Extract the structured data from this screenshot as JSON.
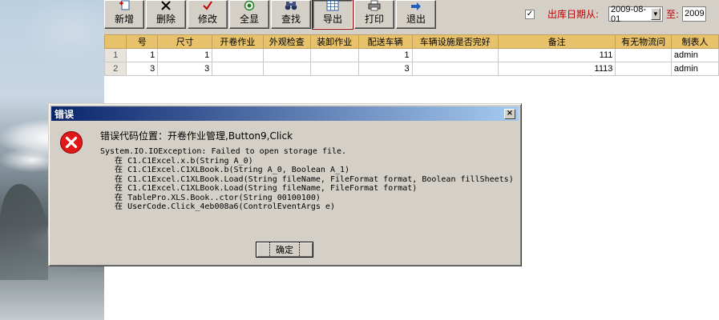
{
  "toolbar": {
    "buttons": [
      {
        "label": "新增",
        "icon": "add-icon"
      },
      {
        "label": "删除",
        "icon": "delete-icon"
      },
      {
        "label": "修改",
        "icon": "check-icon"
      },
      {
        "label": "全显",
        "icon": "show-all-icon"
      },
      {
        "label": "查找",
        "icon": "binoculars-icon"
      },
      {
        "label": "导出",
        "icon": "export-grid-icon"
      },
      {
        "label": "打印",
        "icon": "printer-icon"
      },
      {
        "label": "退出",
        "icon": "exit-arrow-icon"
      }
    ]
  },
  "filter": {
    "checked": true,
    "from_label": "出库日期从:",
    "from_value": "2009-08-01",
    "to_label": "至:",
    "to_value": "2009"
  },
  "grid": {
    "columns": [
      "号",
      "尺寸",
      "开卷作业",
      "外观检查",
      "装卸作业",
      "配送车辆",
      "车辆设施是否完好",
      "备注",
      "有无物流问",
      "制表人"
    ],
    "rows": [
      {
        "rownum": "1",
        "cells": [
          "1",
          "1",
          "",
          "",
          "",
          "1",
          "",
          "111",
          "",
          "admin"
        ]
      },
      {
        "rownum": "2",
        "cells": [
          "3",
          "3",
          "",
          "",
          "",
          "3",
          "",
          "1113",
          "",
          "admin"
        ]
      }
    ]
  },
  "dialog": {
    "title": "错误",
    "close_glyph": "×",
    "error_location": "错误代码位置：开卷作业管理,Button9,Click",
    "stack_lines": [
      "System.IO.IOException: Failed to open storage file.",
      "   在 C1.C1Excel.x.b(String A_0)",
      "   在 C1.C1Excel.C1XLBook.b(String A_0, Boolean A_1)",
      "   在 C1.C1Excel.C1XLBook.Load(String fileName, FileFormat format, Boolean fillSheets)",
      "   在 C1.C1Excel.C1XLBook.Load(String fileName, FileFormat format)",
      "   在 TablePro.XLS.Book..ctor(String 00100100)",
      "   在 UserCode.Click_4eb008a6(ControlEventArgs e)"
    ],
    "ok_label": "确定"
  },
  "colors": {
    "accent_red": "#c00000",
    "header_gold": "#e8c26a",
    "titlebar_start": "#0a246a",
    "titlebar_end": "#a6caf0"
  }
}
